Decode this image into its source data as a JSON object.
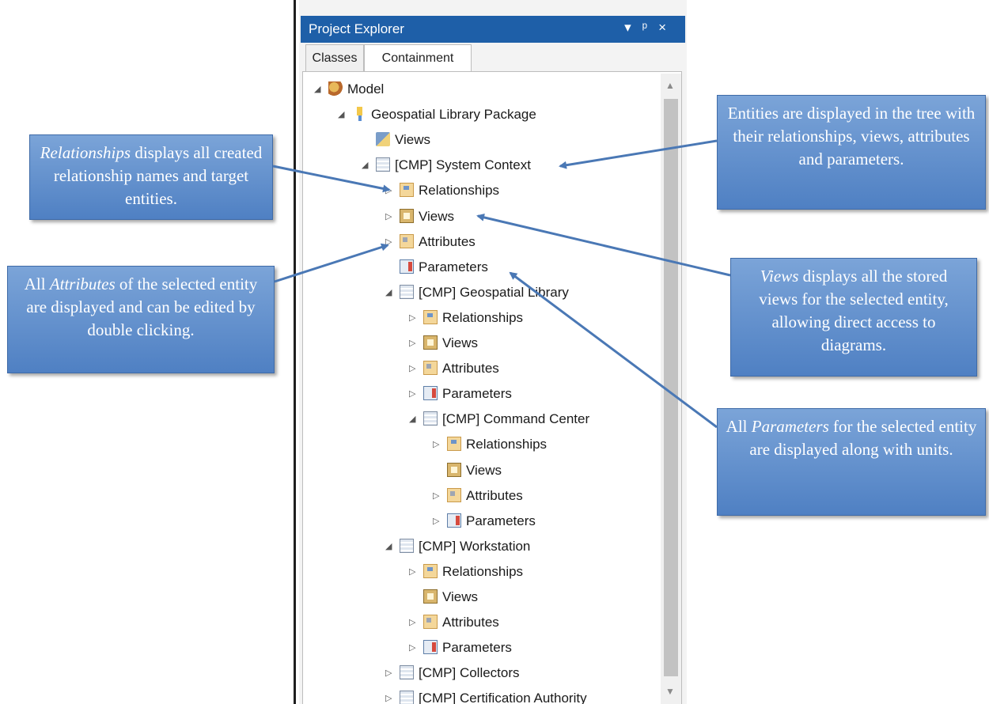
{
  "panel": {
    "title": "Project Explorer",
    "controls": {
      "dropdown": "▾",
      "pin": "ᵖ",
      "close": "×"
    },
    "tabs": [
      {
        "label": "Classes",
        "active": false
      },
      {
        "label": "Containment",
        "active": true
      }
    ]
  },
  "tree": [
    {
      "label": "Model",
      "depth": 0,
      "expander": "expanded",
      "icon": "model-icon"
    },
    {
      "label": "Geospatial Library Package",
      "depth": 1,
      "expander": "expanded",
      "icon": "package-icon"
    },
    {
      "label": "Views",
      "depth": 2,
      "expander": "none",
      "icon": "views-icon"
    },
    {
      "label": "[CMP] System Context",
      "depth": 2,
      "expander": "expanded",
      "icon": "component-icon"
    },
    {
      "label": "Relationships",
      "depth": 3,
      "expander": "collapsed",
      "icon": "relationships-icon"
    },
    {
      "label": "Views",
      "depth": 3,
      "expander": "collapsed",
      "icon": "views-icon"
    },
    {
      "label": "Attributes",
      "depth": 3,
      "expander": "collapsed",
      "icon": "attributes-icon"
    },
    {
      "label": "Parameters",
      "depth": 3,
      "expander": "none",
      "icon": "parameters-icon"
    },
    {
      "label": "[CMP] Geospatial Library",
      "depth": 3,
      "expander": "expanded",
      "icon": "component-icon"
    },
    {
      "label": "Relationships",
      "depth": 4,
      "expander": "collapsed",
      "icon": "relationships-icon"
    },
    {
      "label": "Views",
      "depth": 4,
      "expander": "collapsed",
      "icon": "views-icon"
    },
    {
      "label": "Attributes",
      "depth": 4,
      "expander": "collapsed",
      "icon": "attributes-icon"
    },
    {
      "label": "Parameters",
      "depth": 4,
      "expander": "collapsed",
      "icon": "parameters-icon"
    },
    {
      "label": "[CMP] Command Center",
      "depth": 4,
      "expander": "expanded",
      "icon": "component-icon"
    },
    {
      "label": "Relationships",
      "depth": 5,
      "expander": "collapsed",
      "icon": "relationships-icon"
    },
    {
      "label": "Views",
      "depth": 5,
      "expander": "none",
      "icon": "views-icon"
    },
    {
      "label": "Attributes",
      "depth": 5,
      "expander": "collapsed",
      "icon": "attributes-icon"
    },
    {
      "label": "Parameters",
      "depth": 5,
      "expander": "collapsed",
      "icon": "parameters-icon"
    },
    {
      "label": "[CMP] Workstation",
      "depth": 3,
      "expander": "expanded",
      "icon": "component-icon"
    },
    {
      "label": "Relationships",
      "depth": 4,
      "expander": "collapsed",
      "icon": "relationships-icon"
    },
    {
      "label": "Views",
      "depth": 4,
      "expander": "none",
      "icon": "views-icon"
    },
    {
      "label": "Attributes",
      "depth": 4,
      "expander": "collapsed",
      "icon": "attributes-icon"
    },
    {
      "label": "Parameters",
      "depth": 4,
      "expander": "collapsed",
      "icon": "parameters-icon"
    },
    {
      "label": "[CMP] Collectors",
      "depth": 3,
      "expander": "collapsed",
      "icon": "component-icon"
    },
    {
      "label": "[CMP] Certification Authority",
      "depth": 3,
      "expander": "collapsed",
      "icon": "component-icon"
    }
  ],
  "callouts": {
    "relationships": {
      "em": "Relationships",
      "text": " displays all created relationship names and target entities."
    },
    "attributes": {
      "pre": "All ",
      "em": "Attributes",
      "text": " of the selected entity are displayed and can be edited by double clicking."
    },
    "entities": {
      "text": "Entities are displayed in the tree with their relationships, views, attributes and parameters."
    },
    "views": {
      "em": "Views",
      "text": " displays all the stored views for the selected entity, allowing direct access to diagrams."
    },
    "parameters": {
      "pre": "All ",
      "em": "Parameters",
      "text": " for the selected entity are displayed along with units."
    }
  },
  "colors": {
    "titlebar": "#1e5fa8",
    "callout": "#5a8bcb",
    "arrow": "#4a78b5"
  }
}
